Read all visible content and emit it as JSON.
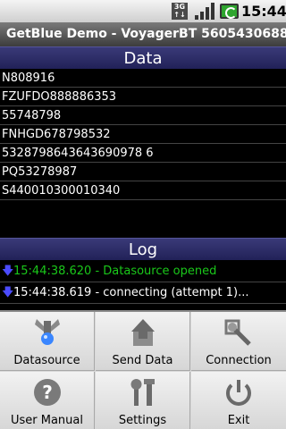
{
  "status_bar": {
    "network_icon": "3g-icon",
    "network_label_top": "3G",
    "network_label_bottom": "↑↓",
    "signal_icon": "signal-icon",
    "battery_icon": "battery-charging-icon",
    "time": "15:44"
  },
  "app_title": "GetBlue Demo - VoyagerBT 5605430688",
  "data_section": {
    "title": "Data",
    "items": [
      "N808916",
      "FZUFDO888886353",
      "55748798",
      "FNHGD678798532",
      "5328798643643690978 6",
      "PQ53278987",
      "S440010300010340"
    ]
  },
  "log_section": {
    "title": "Log",
    "entries": [
      {
        "text": "15:44:38.620 - Datasource opened",
        "color": "#1ac81a"
      },
      {
        "text": "15:44:38.619 - connecting (attempt 1)...",
        "color": "#ffffff"
      }
    ]
  },
  "menu": {
    "items": [
      {
        "label": "Datasource",
        "icon": "datasource-icon"
      },
      {
        "label": "Send Data",
        "icon": "send-data-icon"
      },
      {
        "label": "Connection",
        "icon": "connection-icon"
      },
      {
        "label": "User Manual",
        "icon": "help-icon"
      },
      {
        "label": "Settings",
        "icon": "settings-icon"
      },
      {
        "label": "Exit",
        "icon": "power-icon"
      }
    ]
  }
}
